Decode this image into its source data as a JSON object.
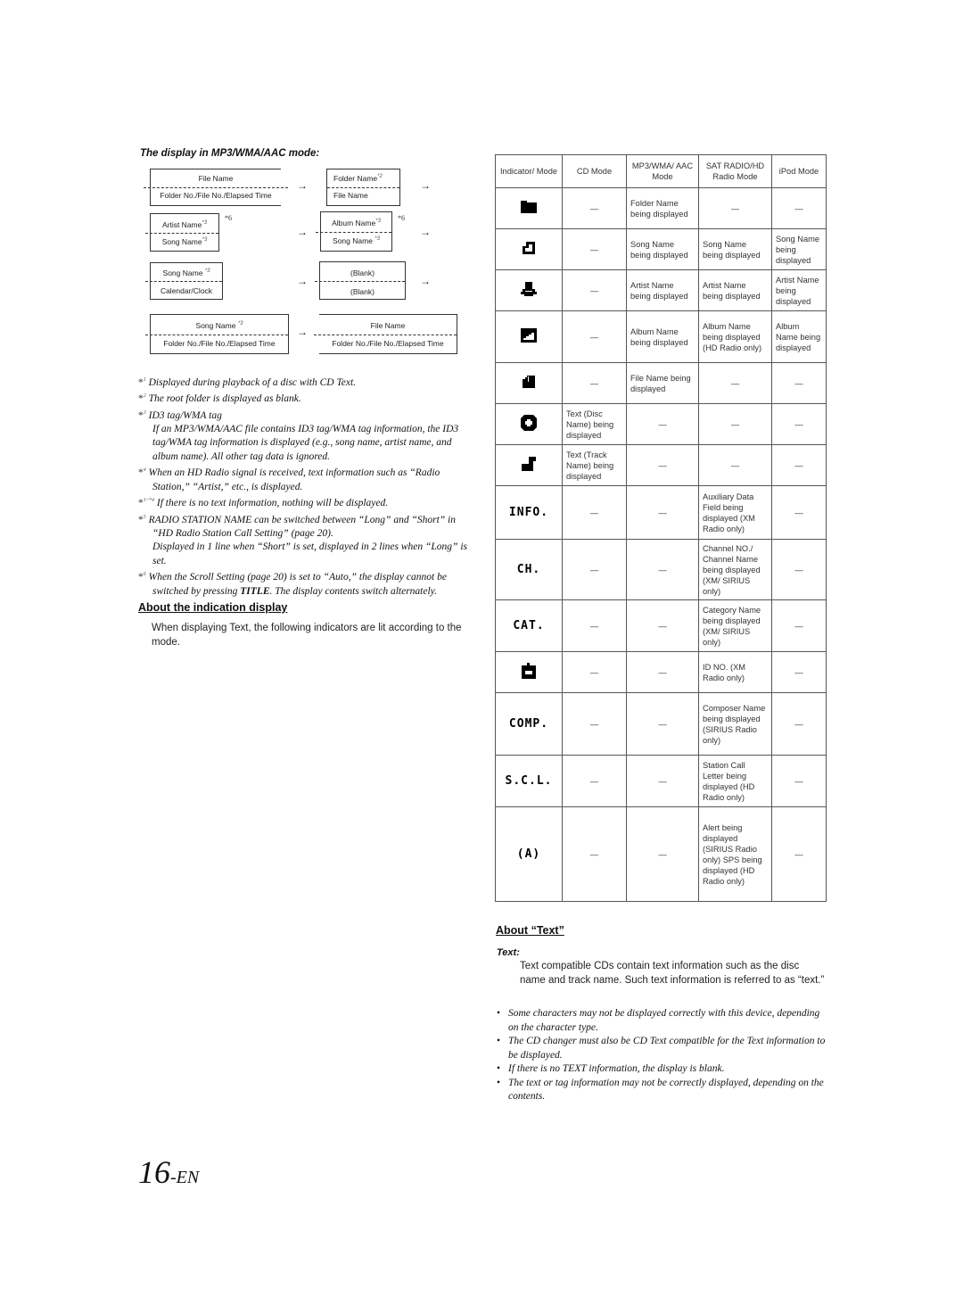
{
  "left": {
    "subheading": "The display in MP3/WMA/AAC mode:",
    "diagram": {
      "arrow": "→",
      "star6": "*6",
      "boxes": [
        {
          "top": "File Name",
          "top_sup": "",
          "bottom": "Folder No./File No./Elapsed Time",
          "bottom_sup": ""
        },
        {
          "top": "Folder Name",
          "top_sup": "*2",
          "bottom": "File Name",
          "bottom_sup": ""
        },
        {
          "top": "Artist Name",
          "top_sup": "*3",
          "bottom": "Song Name",
          "bottom_sup": "*3"
        },
        {
          "top": "Album Name",
          "top_sup": "*3",
          "bottom": "Song Name",
          "bottom_sup": "*3"
        },
        {
          "top": "Song Name",
          "top_sup": "*3",
          "bottom": "Calendar/Clock",
          "bottom_sup": ""
        },
        {
          "top": "(Blank)",
          "top_sup": "",
          "bottom": "(Blank)",
          "bottom_sup": ""
        },
        {
          "top": "Song Name",
          "top_sup": "*3",
          "bottom": "Folder No./File No./Elapsed Time",
          "bottom_sup": ""
        },
        {
          "top": "File Name",
          "top_sup": "",
          "bottom": "Folder No./File No./Elapsed Time",
          "bottom_sup": ""
        }
      ]
    },
    "footnotes": [
      {
        "mark": "*",
        "sup": "1",
        "text": "Displayed during playback of a disc with CD Text."
      },
      {
        "mark": "*",
        "sup": "2",
        "text": "The root folder is displayed as blank."
      },
      {
        "mark": "*",
        "sup": "3",
        "text": "ID3 tag/WMA tag",
        "continuation": "If an MP3/WMA/AAC file contains ID3 tag/WMA tag information, the ID3 tag/WMA tag information is displayed (e.g., song name, artist name, and album name). All other tag data is ignored."
      },
      {
        "mark": "*",
        "sup": "4",
        "text": "When an HD Radio signal is received, text information such as “Radio Station,” “Artist,” etc., is displayed."
      },
      {
        "mark": "*",
        "sup": "1~*4",
        "text": "If there is no text information, nothing will be displayed."
      },
      {
        "mark": "*",
        "sup": "5",
        "text": "RADIO STATION NAME can be switched between “Long” and “Short” in “HD Radio Station Call Setting” (page 20).",
        "continuation": "Displayed in 1 line when “Short” is set, displayed in 2 lines when “Long” is set."
      },
      {
        "mark": "*",
        "sup": "6",
        "text_before": "When the Scroll Setting (page 20) is set to “Auto,” the display cannot be switched by pressing ",
        "bold": "TITLE",
        "text_after": ". The display contents switch alternately."
      }
    ],
    "indication": {
      "heading": "About the indication display",
      "body": "When displaying Text, the following indicators are lit according to the mode."
    }
  },
  "table": {
    "headers": [
      "Indicator/ Mode",
      "CD Mode",
      "MP3/WMA/ AAC Mode",
      "SAT RADIO/HD Radio Mode",
      "iPod Mode"
    ],
    "rows": [
      {
        "indicator": "folder-icon",
        "label": "",
        "cells": [
          "—",
          "Folder Name being displayed",
          "—",
          "—"
        ]
      },
      {
        "indicator": "song-icon",
        "label": "",
        "cells": [
          "—",
          "Song Name being displayed",
          "Song Name being displayed",
          "Song Name being displayed"
        ]
      },
      {
        "indicator": "artist-icon",
        "label": "",
        "cells": [
          "—",
          "Artist Name being displayed",
          "Artist Name being displayed",
          "Artist Name being displayed"
        ]
      },
      {
        "indicator": "album-icon",
        "label": "",
        "cells": [
          "—",
          "Album Name being displayed",
          "Album Name being displayed (HD Radio only)",
          "Album Name being displayed"
        ]
      },
      {
        "indicator": "file-icon",
        "label": "",
        "cells": [
          "—",
          "File Name being displayed",
          "—",
          "—"
        ]
      },
      {
        "indicator": "disc-icon",
        "label": "",
        "cells": [
          "Text (Disc Name) being displayed",
          "—",
          "—",
          "—"
        ]
      },
      {
        "indicator": "track-icon",
        "label": "",
        "cells": [
          "Text (Track Name) being displayed",
          "—",
          "—",
          "—"
        ]
      },
      {
        "indicator": "info-indicator",
        "label": "INFO.",
        "cells": [
          "—",
          "—",
          "Auxiliary Data Field being displayed (XM Radio only)",
          "—"
        ]
      },
      {
        "indicator": "ch-indicator",
        "label": "CH.",
        "cells": [
          "—",
          "—",
          "Channel NO./ Channel Name being displayed (XM/ SIRIUS only)",
          "—"
        ]
      },
      {
        "indicator": "cat-indicator",
        "label": "CAT.",
        "cells": [
          "—",
          "—",
          "Category Name being displayed (XM/ SIRIUS only)",
          "—"
        ]
      },
      {
        "indicator": "id-icon",
        "label": "",
        "cells": [
          "—",
          "—",
          "ID NO. (XM Radio only)",
          "—"
        ]
      },
      {
        "indicator": "comp-indicator",
        "label": "COMP.",
        "cells": [
          "—",
          "—",
          "Composer Name being displayed (SIRIUS Radio only)",
          "—"
        ]
      },
      {
        "indicator": "scl-indicator",
        "label": "S.C.L.",
        "cells": [
          "—",
          "—",
          "Station Call Letter being displayed (HD Radio only)",
          "—"
        ]
      },
      {
        "indicator": "alert-indicator",
        "label": "(A)",
        "cells": [
          "—",
          "—",
          "Alert being displayed (SIRIUS Radio only) SPS being displayed (HD Radio only)",
          "—"
        ]
      }
    ]
  },
  "about_text": {
    "heading": "About “Text”",
    "term": "Text:",
    "definition": "Text compatible CDs contain text information such as the disc name and track name. Such text information is referred to as “text.”",
    "bullets": [
      "Some characters may not be displayed correctly with this device, depending on the character type.",
      "The CD changer must also be CD Text compatible for the Text information to be displayed.",
      "If there is no TEXT information, the display is blank.",
      "The text or tag information may not be correctly displayed, depending on the contents."
    ]
  },
  "page": {
    "number": "16",
    "suffix": "-EN"
  }
}
